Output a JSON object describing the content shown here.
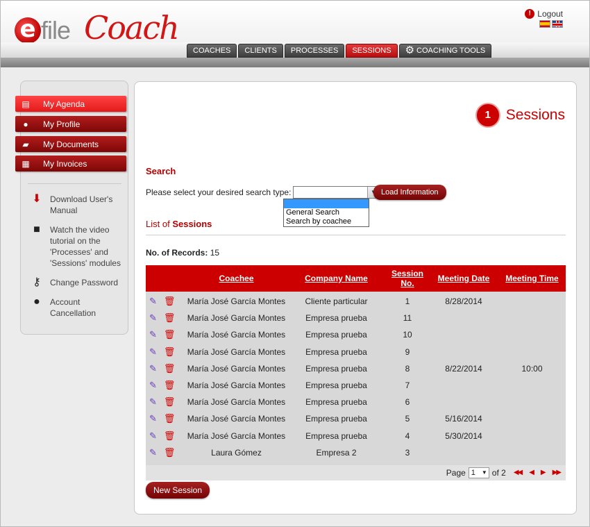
{
  "brand": {
    "logo_e": "e",
    "logo_file": "file",
    "logo_coach": "Coach"
  },
  "header": {
    "logout_label": "Logout",
    "flags": [
      "Spanish",
      "English"
    ]
  },
  "nav": {
    "tabs": [
      {
        "label": "COACHES",
        "active": false
      },
      {
        "label": "CLIENTS",
        "active": false
      },
      {
        "label": "PROCESSES",
        "active": false
      },
      {
        "label": "SESSIONS",
        "active": true
      },
      {
        "label": "COACHING TOOLS",
        "active": false,
        "icon": "gears-icon"
      }
    ]
  },
  "sidebar": {
    "menu": [
      {
        "label": "My Agenda",
        "icon": "calendar-icon",
        "active": true
      },
      {
        "label": "My Profile",
        "icon": "user-icon",
        "active": false
      },
      {
        "label": "My Documents",
        "icon": "folder-icon",
        "active": false
      },
      {
        "label": "My Invoices",
        "icon": "invoice-icon",
        "active": false
      }
    ],
    "links": [
      {
        "label": "Download User's Manual",
        "icon": "pdf-download-icon"
      },
      {
        "label": "Watch the video tutorial on the 'Processes' and 'Sessions' modules",
        "icon": "video-camera-icon"
      },
      {
        "label": "Change Password",
        "icon": "key-icon"
      },
      {
        "label": "Account Cancellation",
        "icon": "user-remove-icon"
      }
    ]
  },
  "main": {
    "title": "Sessions",
    "title_icon": "calendar-1-icon",
    "search": {
      "heading": "Search",
      "prompt": "Please select your desired search type:",
      "selected_value": "",
      "options": [
        "",
        "General Search",
        "Search by coachee"
      ],
      "button": "Load Information"
    },
    "list": {
      "heading_prefix": "List of",
      "heading_bold": "Sessions",
      "records_label": "No. of Records:",
      "records_count": "15"
    },
    "table": {
      "columns": [
        "Coachee",
        "Company Name",
        "Session No.",
        "Meeting Date",
        "Meeting Time"
      ],
      "rows": [
        {
          "coachee": "María José García Montes",
          "company": "Cliente particular",
          "session": "1",
          "date": "8/28/2014",
          "time": ""
        },
        {
          "coachee": "María José García Montes",
          "company": "Empresa prueba",
          "session": "11",
          "date": "",
          "time": ""
        },
        {
          "coachee": "María José García Montes",
          "company": "Empresa prueba",
          "session": "10",
          "date": "",
          "time": ""
        },
        {
          "coachee": "María José García Montes",
          "company": "Empresa prueba",
          "session": "9",
          "date": "",
          "time": ""
        },
        {
          "coachee": "María José García Montes",
          "company": "Empresa prueba",
          "session": "8",
          "date": "8/22/2014",
          "time": "10:00"
        },
        {
          "coachee": "María José García Montes",
          "company": "Empresa prueba",
          "session": "7",
          "date": "",
          "time": ""
        },
        {
          "coachee": "María José García Montes",
          "company": "Empresa prueba",
          "session": "6",
          "date": "",
          "time": ""
        },
        {
          "coachee": "María José García Montes",
          "company": "Empresa prueba",
          "session": "5",
          "date": "5/16/2014",
          "time": ""
        },
        {
          "coachee": "María José García Montes",
          "company": "Empresa prueba",
          "session": "4",
          "date": "5/30/2014",
          "time": ""
        },
        {
          "coachee": "Laura Gómez",
          "company": "Empresa 2",
          "session": "3",
          "date": "",
          "time": ""
        }
      ],
      "pager": {
        "page_label": "Page",
        "page_value": "1",
        "of_label": "of 2"
      }
    },
    "new_button": "New Session"
  },
  "colors": {
    "accent": "#cc0000",
    "dark_red": "#7d0707",
    "table_bg": "#d8d8d8"
  }
}
